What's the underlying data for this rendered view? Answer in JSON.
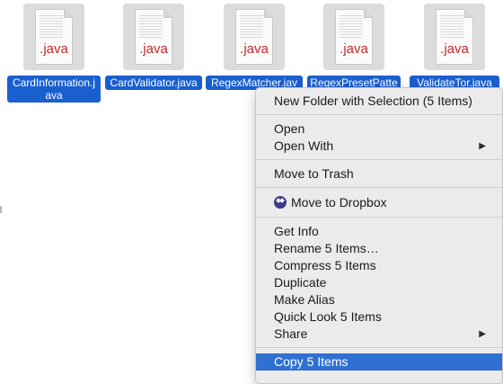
{
  "files": [
    {
      "ext": ".java",
      "label": "CardInformation.java"
    },
    {
      "ext": ".java",
      "label": "CardValidator.java"
    },
    {
      "ext": ".java",
      "label": "RegexMatcher.jav"
    },
    {
      "ext": ".java",
      "label": "RegexPresetPatte"
    },
    {
      "ext": ".java",
      "label": "ValidateTor.java"
    }
  ],
  "menu": {
    "new_folder": "New Folder with Selection (5 Items)",
    "open": "Open",
    "open_with": "Open With",
    "move_to_trash": "Move to Trash",
    "move_to_dropbox": "Move to Dropbox",
    "get_info": "Get Info",
    "rename": "Rename 5 Items…",
    "compress": "Compress 5 Items",
    "duplicate": "Duplicate",
    "make_alias": "Make Alias",
    "quick_look": "Quick Look 5 Items",
    "share": "Share",
    "copy": "Copy 5 Items",
    "submenu_arrow": "▶"
  },
  "icons": {
    "dropbox": "dropbox-icon",
    "file": "java-file-icon"
  },
  "colors": {
    "selection": "#1a5fcf",
    "menu_highlight": "#2f70d3",
    "java_ext": "#c3272b",
    "menu_bg": "#ebebeb"
  }
}
